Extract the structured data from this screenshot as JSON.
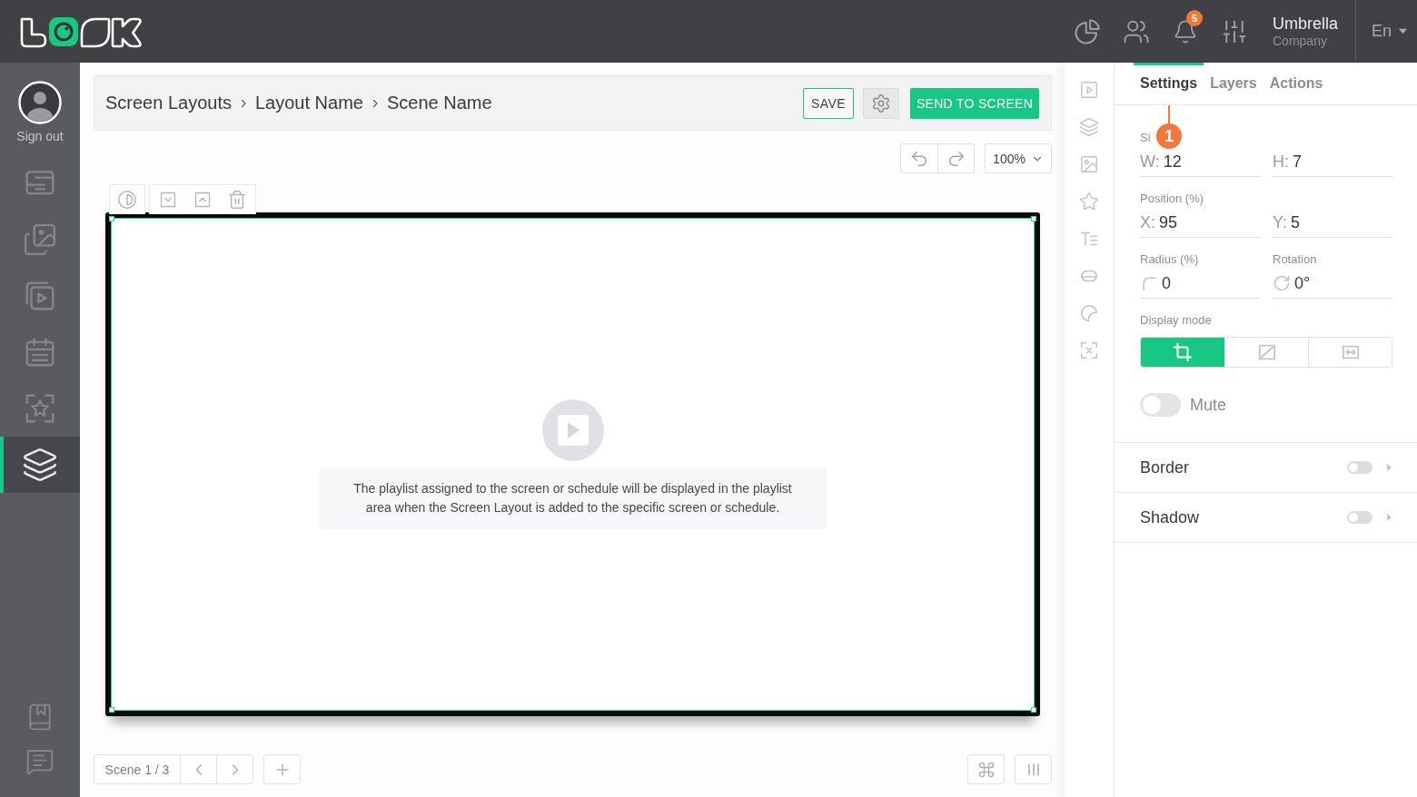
{
  "header": {
    "notification_count": "5",
    "account": {
      "name": "Umbrella",
      "subtitle": "Company"
    },
    "language": "En"
  },
  "sidebar": {
    "sign_out": "Sign out",
    "items": [
      {
        "selected": false
      },
      {
        "selected": false
      },
      {
        "selected": false
      },
      {
        "selected": false
      },
      {
        "selected": false
      },
      {
        "selected": true
      }
    ]
  },
  "editor": {
    "breadcrumb": [
      "Screen Layouts",
      "Layout Name",
      "Scene Name"
    ],
    "save_button": "SAVE",
    "send_button": "SEND TO SCREEN",
    "zoom": "100%",
    "playlist_message": "The playlist assigned to the screen or schedule will be displayed in the playlist area when the Screen Layout is added to the specific screen or schedule.",
    "scene_counter": "Scene 1 / 3"
  },
  "right_panel": {
    "tabs": [
      {
        "label": "Settings",
        "selected": true
      },
      {
        "label": "Layers",
        "selected": false
      },
      {
        "label": "Actions",
        "selected": false
      }
    ],
    "step_marker": "1",
    "rows": [
      {
        "label": "Si",
        "fields": [
          {
            "kind": "text",
            "prefix": "W:",
            "value": "12"
          },
          {
            "kind": "text",
            "prefix": "H:",
            "value": "7"
          }
        ]
      },
      {
        "label": "Position (%)",
        "fields": [
          {
            "kind": "text",
            "prefix": "X:",
            "value": "95"
          },
          {
            "kind": "text",
            "prefix": "Y:",
            "value": "5"
          }
        ]
      },
      {
        "fields": [
          {
            "kind": "radius",
            "label": "Radius (%)",
            "value": "0"
          },
          {
            "kind": "rotation",
            "label": "Rotation",
            "value": "0°"
          }
        ]
      }
    ],
    "display_mode": {
      "label": "Display mode",
      "options": [
        {
          "selected": true
        },
        {
          "selected": false
        },
        {
          "selected": false
        }
      ]
    },
    "mute": {
      "label": "Mute",
      "on": false
    },
    "sections": [
      {
        "label": "Border",
        "on": false
      },
      {
        "label": "Shadow",
        "on": false
      }
    ]
  }
}
